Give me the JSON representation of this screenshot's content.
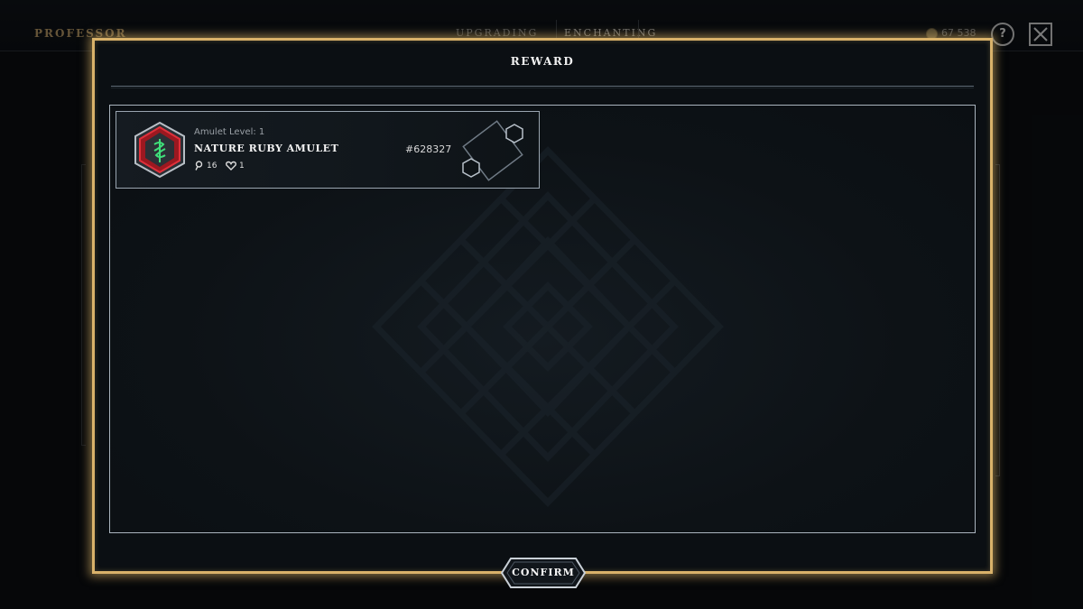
{
  "background": {
    "brand": "PROFESSOR",
    "tabs": [
      {
        "label": "UPGRADING"
      },
      {
        "label": "ENCHANTING"
      }
    ],
    "coins": "67 538",
    "help_icon": "question-icon",
    "close_icon": "close-icon"
  },
  "modal": {
    "title": "REWARD",
    "reward": {
      "level_label": "Amulet Level: 1",
      "name": "NATURE RUBY AMULET",
      "power": "16",
      "life": "1",
      "id": "#628327",
      "icon": "nature-ruby-amulet-icon"
    },
    "confirm_label": "CONFIRM"
  },
  "colors": {
    "gold_border": "#d9b26a",
    "ruby": "#c8202a",
    "nature_green": "#3fe07a",
    "panel_bg": "#0b0f13"
  }
}
